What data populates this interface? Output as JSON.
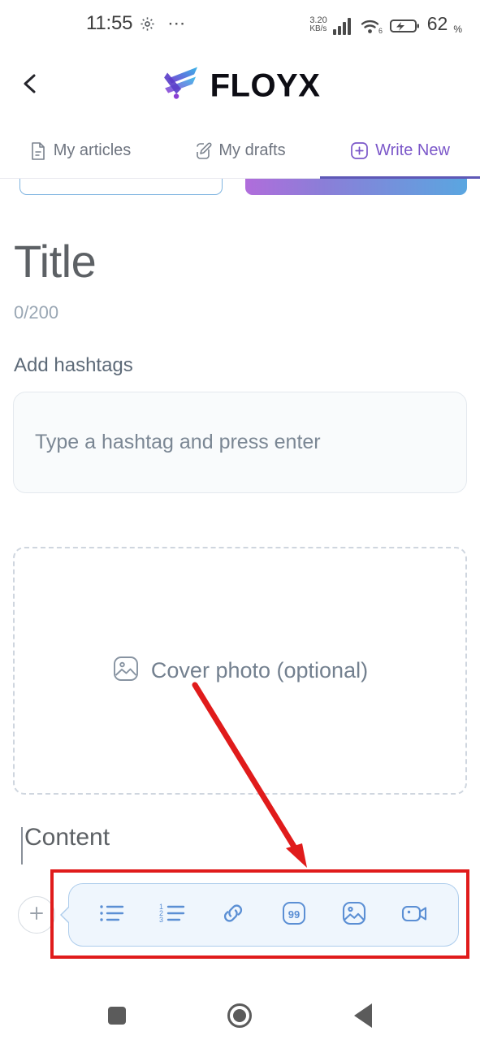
{
  "status_bar": {
    "time": "11:55",
    "gear_icon": "gear-icon",
    "more_icon": "⋯",
    "network_speed_value": "3.20",
    "network_speed_unit": "KB/s",
    "signal_icon": "signal-bars-icon",
    "wifi_icon": "wifi-icon",
    "wifi_generation": "6",
    "battery_icon": "battery-charging-icon",
    "battery_percent": "62",
    "battery_percent_symbol": "%"
  },
  "app_header": {
    "back_icon": "chevron-left-icon",
    "brand_name": "FLOYX",
    "brand_logo": "floyx-logo-icon"
  },
  "tabs": [
    {
      "label": "My articles",
      "icon": "document-icon",
      "active": false
    },
    {
      "label": "My drafts",
      "icon": "pencil-icon",
      "active": false
    },
    {
      "label": "Write New",
      "icon": "plus-square-icon",
      "active": true
    }
  ],
  "editor": {
    "title_placeholder": "Title",
    "title_value": "",
    "char_counter": "0/200",
    "hashtags_label": "Add hashtags",
    "hashtag_placeholder": "Type a hashtag and press enter",
    "hashtag_value": "",
    "cover_photo_label": "Cover photo (optional)",
    "cover_photo_icon": "image-icon",
    "content_placeholder": "Content",
    "content_value": ""
  },
  "insert_toolbar": {
    "add_button_icon": "plus-icon",
    "items": [
      {
        "name": "bullet-list",
        "icon": "bullet-list-icon"
      },
      {
        "name": "numbered-list",
        "icon": "numbered-list-icon"
      },
      {
        "name": "link",
        "icon": "link-icon"
      },
      {
        "name": "quote",
        "icon": "quote-icon",
        "glyph": "99"
      },
      {
        "name": "image",
        "icon": "image-icon"
      },
      {
        "name": "video",
        "icon": "video-camera-icon"
      }
    ]
  },
  "annotation": {
    "highlight_color": "#e01b1b",
    "arrow_color": "#e01b1b"
  },
  "colors": {
    "accent_purple": "#7b57c9",
    "accent_blue": "#5aa6e0",
    "toolbar_blue": "#5b8fd4",
    "muted_text": "#6f7580"
  },
  "android_nav": {
    "recents_icon": "square-icon",
    "home_icon": "circle-icon",
    "back_icon": "triangle-left-icon"
  }
}
